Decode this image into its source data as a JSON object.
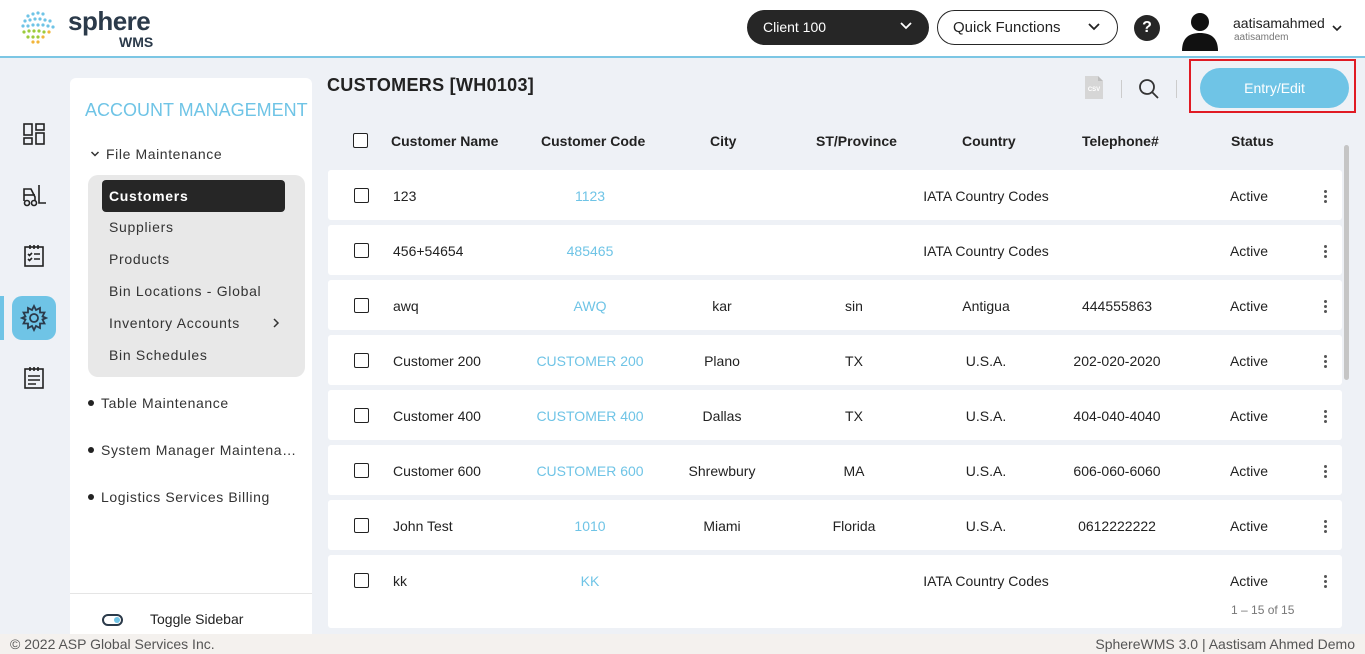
{
  "header": {
    "logo_text": "sphere",
    "logo_sub": "WMS",
    "client_select": "Client 100",
    "quick_functions": "Quick Functions",
    "help_label": "?",
    "user_name": "aatisamahmed",
    "user_sub": "aatisamdem"
  },
  "rail": {
    "icons": [
      "dashboard-icon",
      "forklift-icon",
      "clipboard-icon",
      "gear-icon",
      "report-icon"
    ],
    "active_index": 3
  },
  "sidebar": {
    "title": "ACCOUNT MANAGEMENT",
    "group_label": "File Maintenance",
    "sub_items": [
      "Customers",
      "Suppliers",
      "Products",
      "Bin Locations - Global",
      "Inventory Accounts",
      "Bin Schedules"
    ],
    "active_sub": "Customers",
    "sections": [
      "Table Maintenance",
      "System Manager Maintenance",
      "Logistics Services Billing"
    ],
    "toggle_label": "Toggle Sidebar"
  },
  "main": {
    "title": "CUSTOMERS [WH0103]",
    "csv_label": "CSV",
    "entry_button": "Entry/Edit",
    "columns": [
      "Customer Name",
      "Customer Code",
      "City",
      "ST/Province",
      "Country",
      "Telephone#",
      "Status"
    ],
    "rows": [
      {
        "name": "123",
        "code": "1123",
        "city": "",
        "state": "",
        "country": "IATA Country Codes",
        "phone": "",
        "status": "Active"
      },
      {
        "name": "456+54654",
        "code": "485465",
        "city": "",
        "state": "",
        "country": "IATA Country Codes",
        "phone": "",
        "status": "Active"
      },
      {
        "name": "awq",
        "code": "AWQ",
        "city": "kar",
        "state": "sin",
        "country": "Antigua",
        "phone": "444555863",
        "status": "Active"
      },
      {
        "name": "Customer 200",
        "code": "CUSTOMER 200",
        "city": "Plano",
        "state": "TX",
        "country": "U.S.A.",
        "phone": "202-020-2020",
        "status": "Active"
      },
      {
        "name": "Customer 400",
        "code": "CUSTOMER 400",
        "city": "Dallas",
        "state": "TX",
        "country": "U.S.A.",
        "phone": "404-040-4040",
        "status": "Active"
      },
      {
        "name": "Customer 600",
        "code": "CUSTOMER 600",
        "city": "Shrewbury",
        "state": "MA",
        "country": "U.S.A.",
        "phone": "606-060-6060",
        "status": "Active"
      },
      {
        "name": "John Test",
        "code": "1010",
        "city": "Miami",
        "state": "Florida",
        "country": "U.S.A.",
        "phone": "0612222222",
        "status": "Active"
      },
      {
        "name": "kk",
        "code": "KK",
        "city": "",
        "state": "",
        "country": "IATA Country Codes",
        "phone": "",
        "status": "Active"
      }
    ],
    "pagination": "1 – 15 of 15"
  },
  "footer": {
    "left": "© 2022 ASP Global Services Inc.",
    "right": "SphereWMS 3.0 | Aastisam Ahmed Demo"
  },
  "colors": {
    "accent": "#6fc4e6",
    "dark": "#262626",
    "highlight": "#e01b24"
  }
}
